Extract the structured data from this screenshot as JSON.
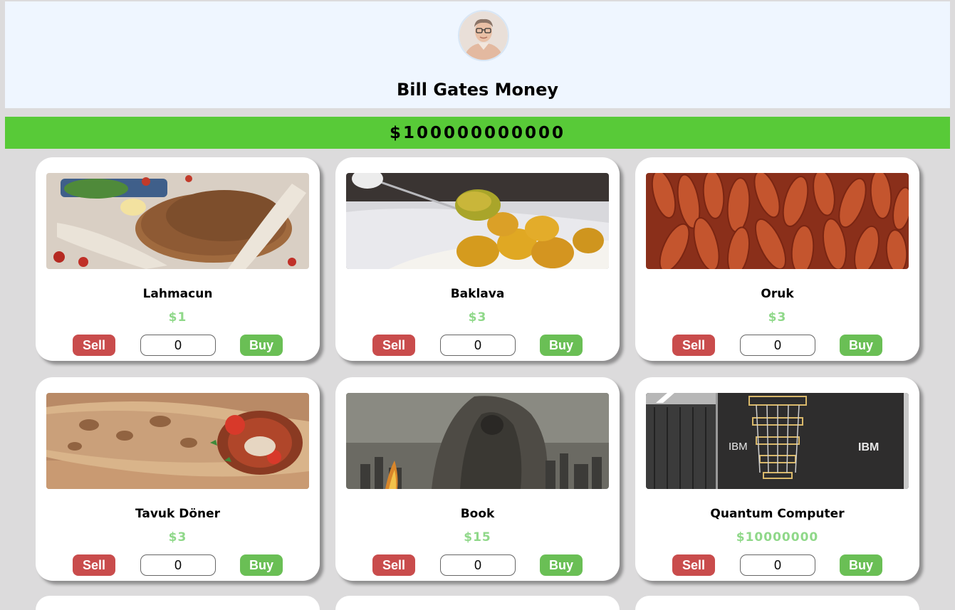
{
  "header": {
    "avatar_icon": "bill-gates-portrait",
    "title": "Bill Gates Money",
    "background": "#eff6ff"
  },
  "money": {
    "amount": "$100000000000",
    "bar_color": "#58ca38"
  },
  "colors": {
    "sell": "#c94c4c",
    "buy": "#6abf55",
    "price": "#8fd889"
  },
  "products": [
    {
      "name": "Lahmacun",
      "price": "$1",
      "quantity": "0",
      "sell_label": "Sell",
      "buy_label": "Buy",
      "image_icon": "lahmacun-photo"
    },
    {
      "name": "Baklava",
      "price": "$3",
      "quantity": "0",
      "sell_label": "Sell",
      "buy_label": "Buy",
      "image_icon": "baklava-photo"
    },
    {
      "name": "Oruk",
      "price": "$3",
      "quantity": "0",
      "sell_label": "Sell",
      "buy_label": "Buy",
      "image_icon": "oruk-photo"
    },
    {
      "name": "Tavuk Döner",
      "price": "$3",
      "quantity": "0",
      "sell_label": "Sell",
      "buy_label": "Buy",
      "image_icon": "doner-photo"
    },
    {
      "name": "Book",
      "price": "$15",
      "quantity": "0",
      "sell_label": "Sell",
      "buy_label": "Buy",
      "image_icon": "book-cover-photo"
    },
    {
      "name": "Quantum Computer",
      "price": "$10000000",
      "quantity": "0",
      "sell_label": "Sell",
      "buy_label": "Buy",
      "image_icon": "quantum-computer-photo",
      "image_text_left": "IBM",
      "image_text_right": "IBM"
    }
  ]
}
